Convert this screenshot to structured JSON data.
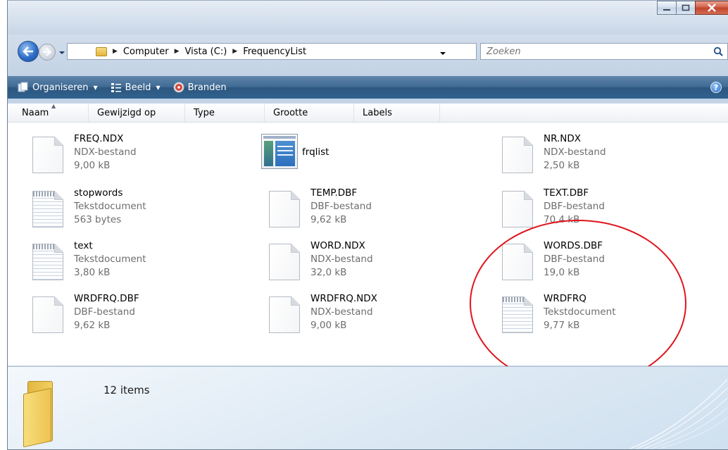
{
  "address": {
    "crumbs": [
      "Computer",
      "Vista (C:)",
      "FrequencyList"
    ]
  },
  "search": {
    "placeholder": "Zoeken"
  },
  "toolbar": {
    "organize_label": "Organiseren",
    "view_label": "Beeld",
    "burn_label": "Branden"
  },
  "columns": [
    "Naam",
    "Gewijzigd op",
    "Type",
    "Grootte",
    "Labels"
  ],
  "files": [
    {
      "name": "FREQ.NDX",
      "type": "NDX-bestand",
      "size": "9,00 kB",
      "icon": "document-icon"
    },
    {
      "name": "frqlist",
      "type": "",
      "size": "",
      "icon": "application-icon"
    },
    {
      "name": "NR.NDX",
      "type": "NDX-bestand",
      "size": "2,50 kB",
      "icon": "document-icon"
    },
    {
      "name": "stopwords",
      "type": "Tekstdocument",
      "size": "563 bytes",
      "icon": "text-document-icon"
    },
    {
      "name": "TEMP.DBF",
      "type": "DBF-bestand",
      "size": "9,62 kB",
      "icon": "document-icon"
    },
    {
      "name": "TEXT.DBF",
      "type": "DBF-bestand",
      "size": "70,4 kB",
      "icon": "document-icon"
    },
    {
      "name": "text",
      "type": "Tekstdocument",
      "size": "3,80 kB",
      "icon": "text-document-icon"
    },
    {
      "name": "WORD.NDX",
      "type": "NDX-bestand",
      "size": "32,0 kB",
      "icon": "document-icon"
    },
    {
      "name": "WORDS.DBF",
      "type": "DBF-bestand",
      "size": "19,0 kB",
      "icon": "document-icon"
    },
    {
      "name": "WRDFRQ.DBF",
      "type": "DBF-bestand",
      "size": "9,62 kB",
      "icon": "document-icon"
    },
    {
      "name": "WRDFRQ.NDX",
      "type": "NDX-bestand",
      "size": "9,00 kB",
      "icon": "document-icon"
    },
    {
      "name": "WRDFRQ",
      "type": "Tekstdocument",
      "size": "9,77 kB",
      "icon": "text-document-icon"
    }
  ],
  "details": {
    "count": "12 items"
  },
  "colors": {
    "annotation": "#e0141c",
    "command_bar": "#3f6a93"
  }
}
